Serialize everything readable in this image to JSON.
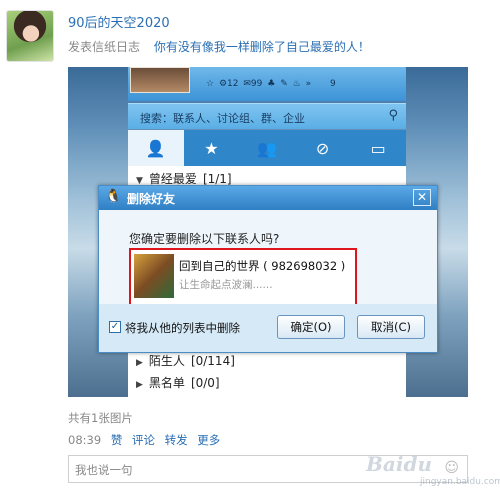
{
  "user": {
    "name": "90后的天空2020"
  },
  "post": {
    "source": "发表信纸日志",
    "text": "你有没有像我一样删除了自己最爱的人！"
  },
  "qq": {
    "status_icons": [
      "☆",
      "⚙12",
      "✉99",
      "♣",
      "✎",
      "♨",
      "»"
    ],
    "status_count_right": "9",
    "search_placeholder": "搜索：联系人、讨论组、群、企业",
    "groups": [
      {
        "label": "曾经最爱",
        "count": "[1/1]"
      },
      {
        "label": "陌生人",
        "count": "[0/114]"
      },
      {
        "label": "黑名单",
        "count": "[0/0]"
      }
    ]
  },
  "dialog": {
    "title": "删除好友",
    "question": "您确定要删除以下联系人吗?",
    "contact_name": "回到自己的世界 ( 982698032 )",
    "contact_status": "让生命起点波澜......",
    "checkbox_label": "将我从他的列表中删除",
    "checkbox_checked": true,
    "ok_label": "确定(O)",
    "cancel_label": "取消(C)"
  },
  "meta": {
    "pics_count": "共有1张图片",
    "time": "08:39",
    "like": "赞",
    "comment": "评论",
    "forward": "转发",
    "more": "更多"
  },
  "comment": {
    "placeholder": "我也说一句"
  },
  "watermark": {
    "logo": "Baidu",
    "sub": "jingyan.baidu.com"
  }
}
